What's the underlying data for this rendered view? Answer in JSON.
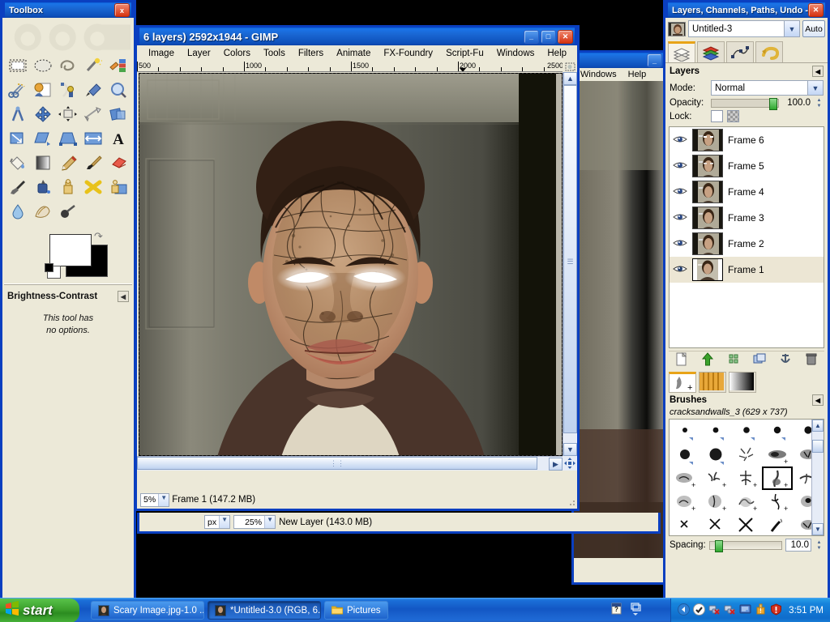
{
  "toolbox": {
    "title": "Toolbox",
    "close_label": "x",
    "tools": [
      {
        "name": "rect-select-tool",
        "label": "Rectangle Select"
      },
      {
        "name": "ellipse-select-tool",
        "label": "Ellipse Select"
      },
      {
        "name": "free-select-tool",
        "label": "Free Select"
      },
      {
        "name": "fuzzy-select-tool",
        "label": "Fuzzy Select"
      },
      {
        "name": "select-by-color-tool",
        "label": "Select by Color"
      },
      {
        "name": "scissors-select-tool",
        "label": "Scissors Select"
      },
      {
        "name": "foreground-select-tool",
        "label": "Foreground Select"
      },
      {
        "name": "paths-tool",
        "label": "Paths"
      },
      {
        "name": "color-picker-tool",
        "label": "Color Picker"
      },
      {
        "name": "zoom-tool",
        "label": "Zoom"
      },
      {
        "name": "measure-tool",
        "label": "Measure"
      },
      {
        "name": "move-tool",
        "label": "Move"
      },
      {
        "name": "alignment-tool",
        "label": "Alignment"
      },
      {
        "name": "crop-tool",
        "label": "Crop"
      },
      {
        "name": "rotate-tool",
        "label": "Rotate"
      },
      {
        "name": "scale-tool",
        "label": "Scale"
      },
      {
        "name": "shear-tool",
        "label": "Shear"
      },
      {
        "name": "perspective-tool",
        "label": "Perspective"
      },
      {
        "name": "flip-tool",
        "label": "Flip"
      },
      {
        "name": "text-tool",
        "label": "Text"
      },
      {
        "name": "bucket-fill-tool",
        "label": "Bucket Fill"
      },
      {
        "name": "gradient-tool",
        "label": "Blend"
      },
      {
        "name": "pencil-tool",
        "label": "Pencil"
      },
      {
        "name": "paintbrush-tool",
        "label": "Paintbrush"
      },
      {
        "name": "eraser-tool",
        "label": "Eraser"
      },
      {
        "name": "airbrush-tool",
        "label": "Airbrush"
      },
      {
        "name": "ink-tool",
        "label": "Ink"
      },
      {
        "name": "clone-tool",
        "label": "Clone"
      },
      {
        "name": "heal-tool",
        "label": "Heal"
      },
      {
        "name": "perspective-clone-tool",
        "label": "Perspective Clone"
      },
      {
        "name": "blur-sharpen-tool",
        "label": "Blur / Sharpen"
      },
      {
        "name": "smudge-tool",
        "label": "Smudge"
      },
      {
        "name": "dodge-burn-tool",
        "label": "Dodge / Burn"
      }
    ],
    "foreground_color": "#ffffff",
    "background_color": "#000000",
    "tool_options_title": "Brightness-Contrast",
    "tool_options_text_line1": "This tool has",
    "tool_options_text_line2": "no options."
  },
  "image_window": {
    "title": "6 layers) 2592x1944 - GIMP",
    "minimize_label": "_",
    "maximize_label": "□",
    "close_label": "✕",
    "menus": [
      "Image",
      "Layer",
      "Colors",
      "Tools",
      "Filters",
      "Animate",
      "FX-Foundry",
      "Script-Fu",
      "Windows",
      "Help"
    ],
    "ruler_labels": [
      "500",
      "1000",
      "1500",
      "2000",
      "2500"
    ],
    "zoom_value": "5%",
    "status_text": "Frame 1 (147.2 MB)"
  },
  "background_window": {
    "menus": [
      "Windows",
      "Help"
    ],
    "minimize_label": "_",
    "unit_value": "px",
    "zoom_value": "25%",
    "status_text": "New Layer (143.0 MB)"
  },
  "dock": {
    "title": "Layers, Channels, Paths, Undo -...",
    "close_label": "✕",
    "image_name": "Untitled-3",
    "auto_label": "Auto",
    "tabs": [
      {
        "name": "tab-layers",
        "label": "Layers"
      },
      {
        "name": "tab-channels",
        "label": "Channels"
      },
      {
        "name": "tab-paths",
        "label": "Paths"
      },
      {
        "name": "tab-undo-history",
        "label": "Undo History"
      }
    ],
    "layers_panel": {
      "title": "Layers",
      "mode_label": "Mode:",
      "mode_value": "Normal",
      "opacity_label": "Opacity:",
      "opacity_value": "100.0",
      "lock_label": "Lock:",
      "layers": [
        {
          "name": "Frame 6",
          "visible": true,
          "selected": false
        },
        {
          "name": "Frame 5",
          "visible": true,
          "selected": false
        },
        {
          "name": "Frame 4",
          "visible": true,
          "selected": false
        },
        {
          "name": "Frame 3",
          "visible": true,
          "selected": false
        },
        {
          "name": "Frame 2",
          "visible": true,
          "selected": false
        },
        {
          "name": "Frame 1",
          "visible": true,
          "selected": true
        }
      ],
      "buttons": [
        "new-layer",
        "raise-layer",
        "duplicate-layer",
        "merge-down",
        "anchor-layer",
        "delete-layer"
      ]
    },
    "brushes_panel": {
      "title": "Brushes",
      "selected_brush": "cracksandwalls_3 (629 x 737)",
      "spacing_label": "Spacing:",
      "spacing_value": "10.0",
      "tabs": [
        "brushes",
        "patterns",
        "gradients"
      ]
    }
  },
  "taskbar": {
    "start_label": "start",
    "tasks": [
      {
        "label": "Scary Image.jpg-1.0 ...",
        "active": false
      },
      {
        "label": "*Untitled-3.0 (RGB, 6...",
        "active": true
      },
      {
        "label": "Pictures",
        "active": false
      }
    ],
    "clock": "3:51 PM",
    "tray_icons": [
      "show-desktop-icon",
      "shield-ok-icon",
      "network-disconnected-icon",
      "network-disconnected-icon",
      "monitor-icon",
      "update-icon",
      "security-alert-icon"
    ]
  },
  "colors": {
    "xp_blue": "#0a3fc0",
    "window_face": "#ece9d8",
    "accent_orange": "#e8a317",
    "taskbar_blue": "#1357c4"
  }
}
